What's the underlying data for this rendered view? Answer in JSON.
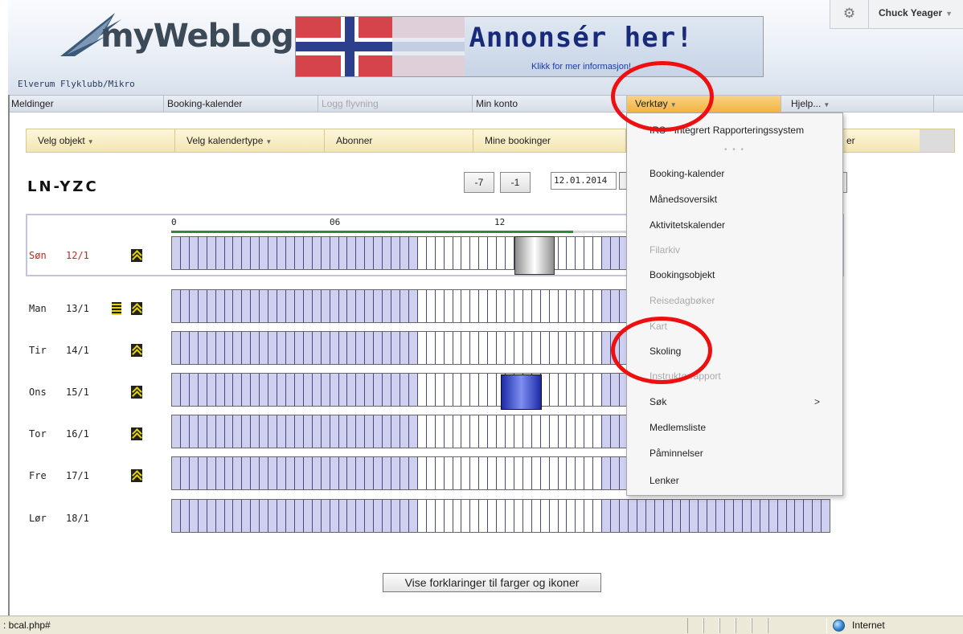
{
  "header": {
    "logo_text": "myWebLog",
    "club_name": "Elverum Flyklubb/Mikro",
    "banner_title": "Annonsér her!",
    "banner_subtitle": "Klikk for mer informasjon!",
    "user_name": "Chuck Yeager",
    "settings_icon": "gear-icon"
  },
  "nav": {
    "items": [
      {
        "label": "Meldinger"
      },
      {
        "label": "Booking-kalender"
      },
      {
        "label": "Logg flyvning"
      },
      {
        "label": "Min konto"
      },
      {
        "label": "Verktøy"
      },
      {
        "label": "Hjelp..."
      }
    ]
  },
  "subnav": {
    "items": [
      {
        "label": "Velg objekt"
      },
      {
        "label": "Velg kalendertype"
      },
      {
        "label": "Abonner"
      },
      {
        "label": "Mine bookinger"
      },
      {
        "label": "er"
      }
    ]
  },
  "calendar": {
    "object_title": "LN-YZC",
    "btn_minus7": "-7",
    "btn_minus1": "-1",
    "date_value": "12.01.2014",
    "hour_labels": [
      "0",
      "06",
      "12"
    ],
    "day_progress_fraction": 0.61,
    "days": [
      {
        "name": "Søn",
        "date": "12/1"
      },
      {
        "name": "Man",
        "date": "13/1"
      },
      {
        "name": "Tir",
        "date": "14/1"
      },
      {
        "name": "Ons",
        "date": "15/1"
      },
      {
        "name": "Tor",
        "date": "16/1"
      },
      {
        "name": "Fre",
        "date": "17/1"
      },
      {
        "name": "Lør",
        "date": "18/1"
      }
    ],
    "legend_button": "Vise forklaringer til farger og ikoner"
  },
  "dropdown": {
    "items": [
      {
        "label": "IRS - Integrert Rapporteringssystem",
        "enabled": true
      },
      {
        "label": "Booking-kalender",
        "enabled": true
      },
      {
        "label": "Månedsoversikt",
        "enabled": true
      },
      {
        "label": "Aktivitetskalender",
        "enabled": true
      },
      {
        "label": "Filarkiv",
        "enabled": false
      },
      {
        "label": "Bookingsobjekt",
        "enabled": true
      },
      {
        "label": "Reisedagbøker",
        "enabled": false
      },
      {
        "label": "Kart",
        "enabled": false
      },
      {
        "label": "Skoling",
        "enabled": true
      },
      {
        "label": "Instruktørrapport",
        "enabled": false
      },
      {
        "label": "Søk",
        "enabled": true
      },
      {
        "label": "Medlemsliste",
        "enabled": true
      },
      {
        "label": "Påminnelser",
        "enabled": true
      },
      {
        "label": "Lenker",
        "enabled": true
      }
    ],
    "separator": "• • •",
    "submenu_arrow": ">"
  },
  "statusbar": {
    "left_text": ": bcal.php#",
    "zone_label": "Internet",
    "zone_icon": "globe-icon"
  },
  "colors": {
    "night_cell": "#cfcff0",
    "highlight_ring": "#ee1010",
    "active_nav": "#f2b540"
  }
}
